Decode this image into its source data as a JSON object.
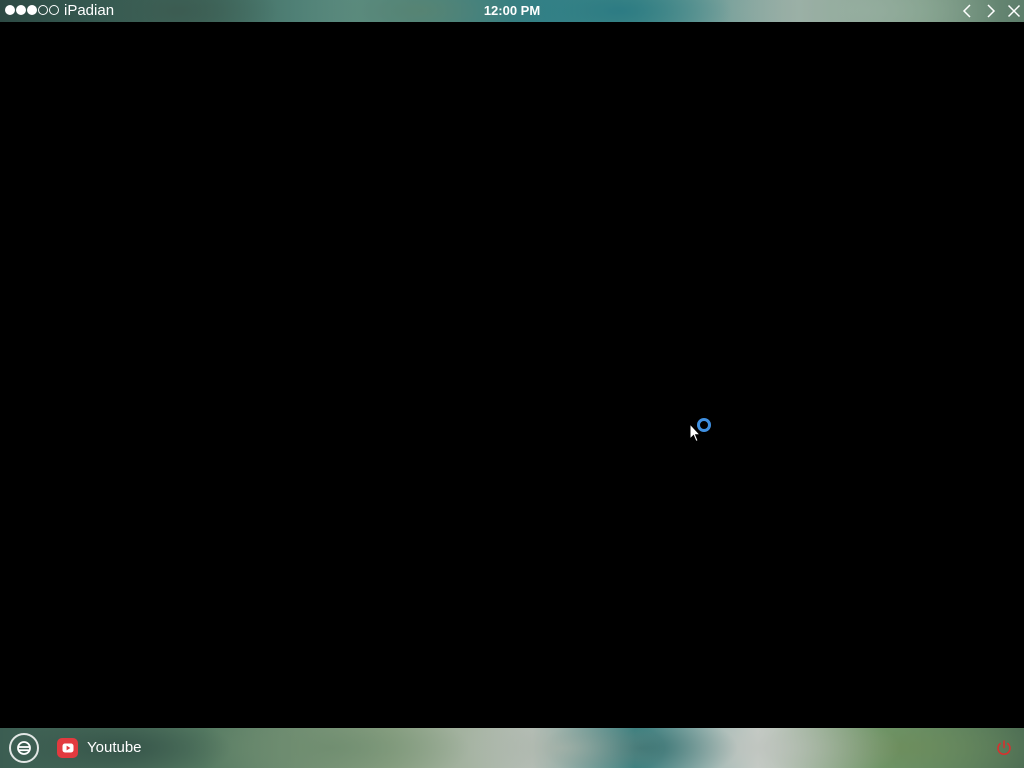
{
  "status_bar": {
    "signal_dots": [
      true,
      true,
      true,
      false,
      false
    ],
    "app_name": "iPadian",
    "time": "12:00 PM",
    "nav": {
      "back_icon": "chevron-left-icon",
      "forward_icon": "chevron-right-icon",
      "close_icon": "close-icon"
    }
  },
  "main": {
    "background": "#000000",
    "loading_indicator_color": "#3f8fe0"
  },
  "dock": {
    "browser_icon": "browser-icon",
    "tasks": [
      {
        "label": "Youtube",
        "icon": "youtube-icon",
        "icon_color": "#e23a3f"
      }
    ],
    "power_icon": "power-icon",
    "power_color": "#d9302e"
  }
}
